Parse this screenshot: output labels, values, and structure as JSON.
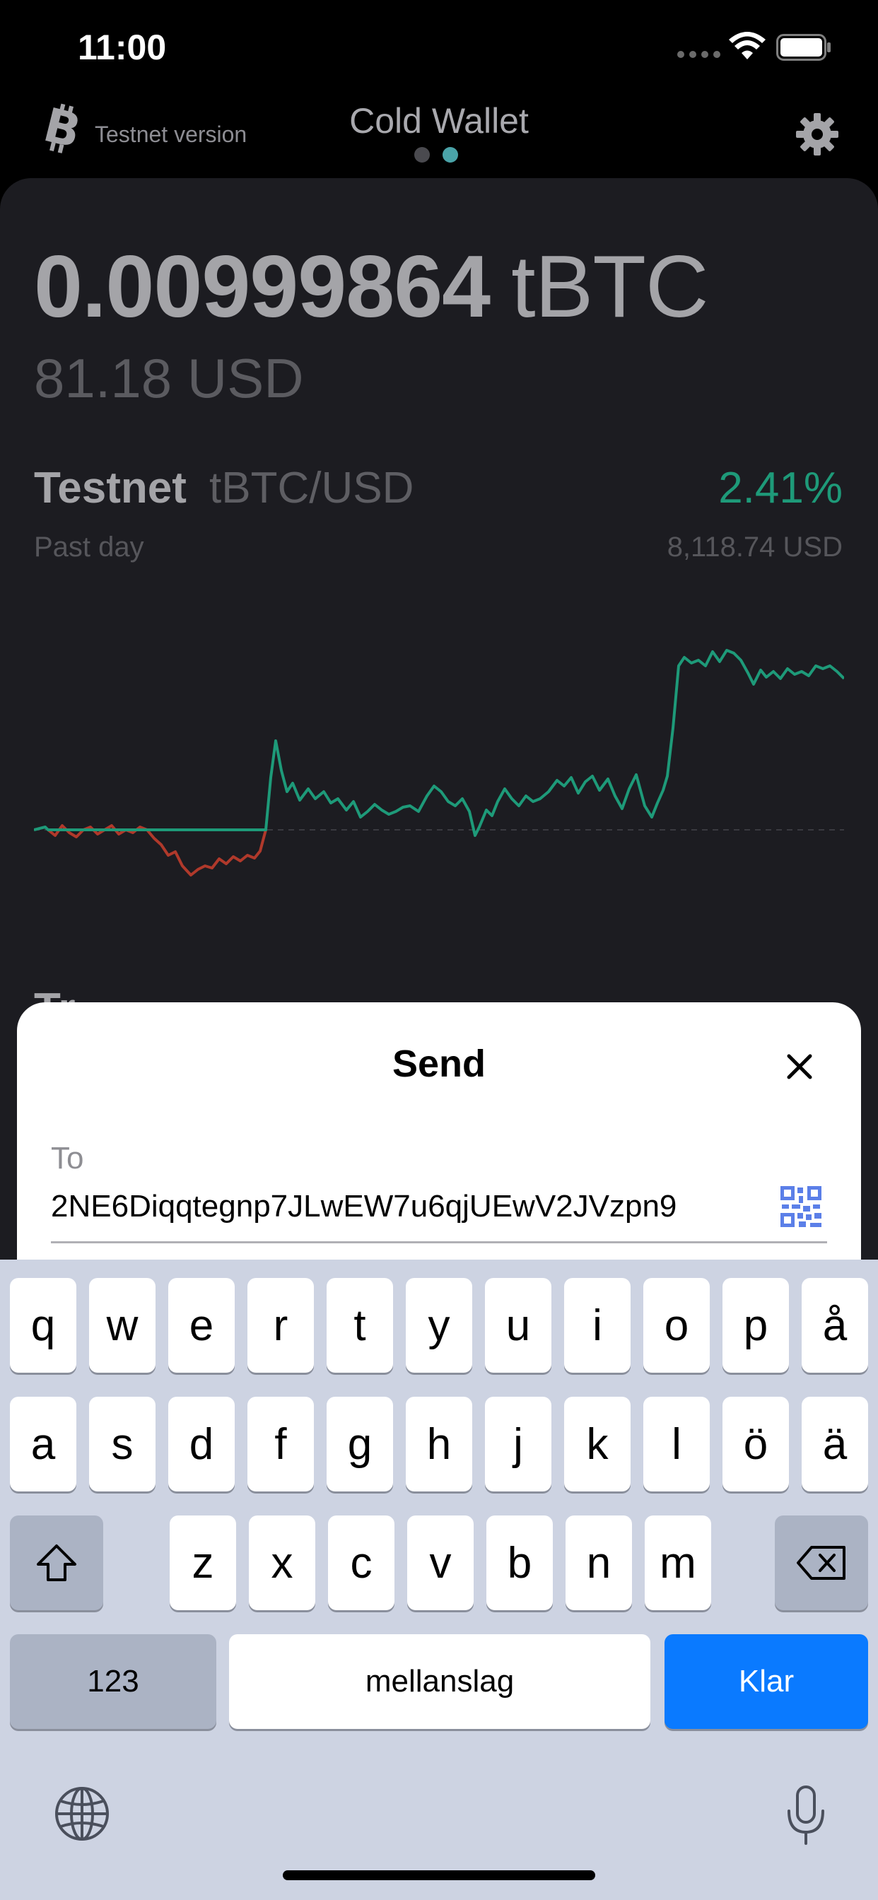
{
  "status_bar": {
    "time": "11:00"
  },
  "header": {
    "network_label": "Testnet version",
    "title": "Cold Wallet",
    "pages": 2,
    "active_page": 2
  },
  "balance": {
    "amount": "0.00999864",
    "unit": "tBTC",
    "fiat": "81.18 USD"
  },
  "market": {
    "name": "Testnet",
    "pair": "tBTC/USD",
    "change": "2.41%",
    "period": "Past day",
    "price": "8,118.74 USD"
  },
  "section_peek": "Tr",
  "send_sheet": {
    "title": "Send",
    "to_label": "To",
    "address": "2NE6Diqqtegnp7JLwEW7u6qjUEwV2JVzpn9"
  },
  "keyboard": {
    "row1": [
      "q",
      "w",
      "e",
      "r",
      "t",
      "y",
      "u",
      "i",
      "o",
      "p",
      "å"
    ],
    "row2": [
      "a",
      "s",
      "d",
      "f",
      "g",
      "h",
      "j",
      "k",
      "l",
      "ö",
      "ä"
    ],
    "row3": [
      "z",
      "x",
      "c",
      "v",
      "b",
      "n",
      "m"
    ],
    "numbers_label": "123",
    "space_label": "mellanslag",
    "return_label": "Klar"
  },
  "colors": {
    "up": "#1e9a79",
    "down": "#b0392b",
    "accent_dot": "#4aa3a8",
    "return_key": "#0a7aff"
  }
}
